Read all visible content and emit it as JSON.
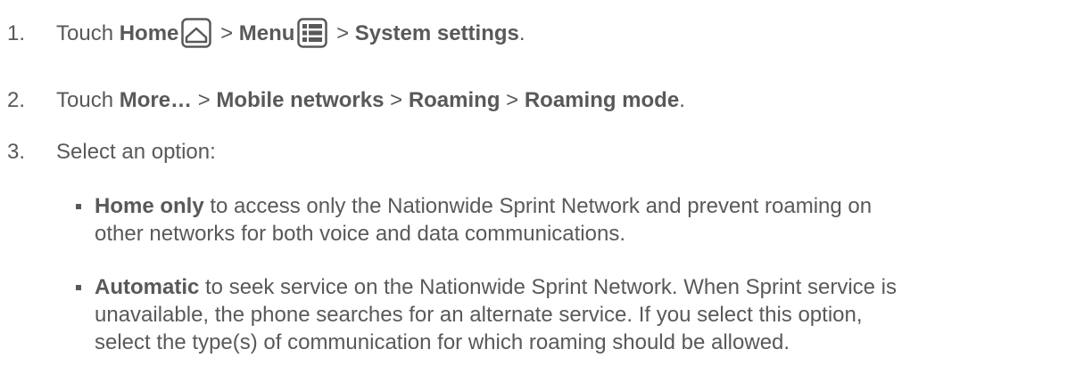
{
  "steps": [
    {
      "number": "1.",
      "prefix": "Touch ",
      "home": "Home",
      "sep1": " > ",
      "menu": "Menu",
      "sep2": " > ",
      "target": "System settings",
      "suffix": ".",
      "icons": [
        "home-icon",
        "menu-icon"
      ]
    },
    {
      "number": "2.",
      "prefix": "Touch ",
      "more": "More…",
      "sep1": " > ",
      "mobile": "Mobile networks",
      "sep2": " > ",
      "roaming": "Roaming",
      "sep3": " > ",
      "mode": "Roaming mode",
      "suffix": "."
    },
    {
      "number": "3.",
      "text": "Select an option:"
    }
  ],
  "options": [
    {
      "bold": "Home only",
      "line1": " to access only the Nationwide Sprint Network and prevent roaming on",
      "line2": "other networks for both voice and data communications."
    },
    {
      "bold": "Automatic",
      "line1": " to seek service on the Nationwide Sprint Network. When Sprint service is",
      "line2": "unavailable, the phone searches for an alternate service. If you select this option,",
      "line3": "select the type(s) of communication for which roaming should be allowed."
    }
  ]
}
